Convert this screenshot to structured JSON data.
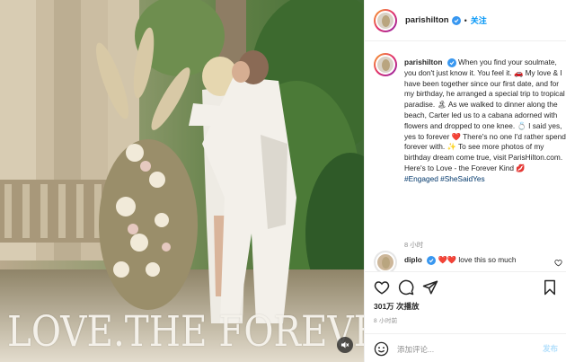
{
  "post": {
    "username": "parishilton",
    "follow_label": "关注",
    "dot": "•",
    "overlay_title": "LOVE.THE FOREVER KIND"
  },
  "caption": {
    "username": "parishilton",
    "text_parts": [
      "When you find your soulmate, you don't just know it. You feel it. ",
      "🚗",
      " My love & I have been together since our first date, and for my birthday, he arranged a special trip to tropical paradise. ",
      "🏝",
      " As we walked to dinner along the beach, Carter led us to a cabana adorned with flowers and dropped to one knee. ",
      "💍",
      " I said yes, yes to forever ",
      "❤️",
      " There's no one I'd rather spend forever with. ",
      "✨",
      " To see more photos of my birthday dream come true, visit ParisHilton.com. Here's to Love - the Forever Kind ",
      "💋"
    ],
    "hashtags": [
      "#Engaged",
      "#SheSaidYes"
    ],
    "time": "8 小时"
  },
  "comment": {
    "username": "diplo",
    "hearts": "❤️❤️",
    "text": " love this so much"
  },
  "stats": {
    "views": "301万 次播放",
    "time_ago": "8 小时前"
  },
  "input": {
    "placeholder": "添加评论...",
    "post_label": "发布"
  },
  "colors": {
    "accent": "#0095f6",
    "verified": "#3897f0",
    "hashtag": "#00376b",
    "muted_text": "#8e8e8e",
    "post_disabled": "#b2dffc"
  },
  "icons": [
    "verified-badge-icon",
    "heart-icon",
    "comment-icon",
    "share-icon",
    "bookmark-icon",
    "emoji-icon",
    "mute-icon"
  ]
}
